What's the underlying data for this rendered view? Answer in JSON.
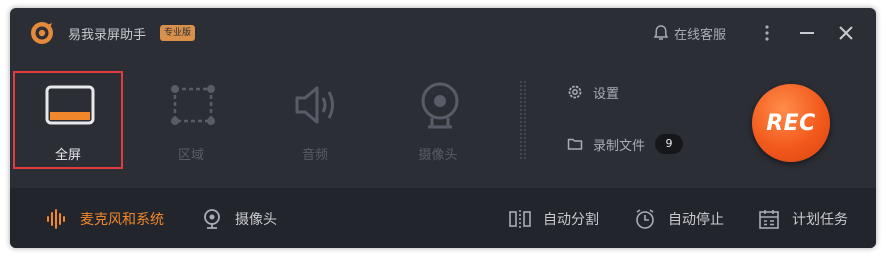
{
  "app": {
    "title": "易我录屏助手",
    "edition_badge": "专业版",
    "support_label": "在线客服"
  },
  "modes": [
    {
      "label": "全屏",
      "active": true,
      "icon": "fullscreen-icon"
    },
    {
      "label": "区域",
      "active": false,
      "icon": "region-icon"
    },
    {
      "label": "音频",
      "active": false,
      "icon": "speaker-icon"
    },
    {
      "label": "摄像头",
      "active": false,
      "icon": "webcam-icon"
    }
  ],
  "side": {
    "settings_label": "设置",
    "files_label": "录制文件",
    "files_count": "9"
  },
  "rec_label": "REC",
  "bottom": {
    "mic_label": "麦克风和系统",
    "camera_label": "摄像头",
    "split_label": "自动分割",
    "stop_label": "自动停止",
    "schedule_label": "计划任务"
  },
  "colors": {
    "accent_orange": "#f0872b",
    "rec_red": "#f25a1c",
    "selection_border": "#e23b3b",
    "background": "#2b2e35"
  }
}
